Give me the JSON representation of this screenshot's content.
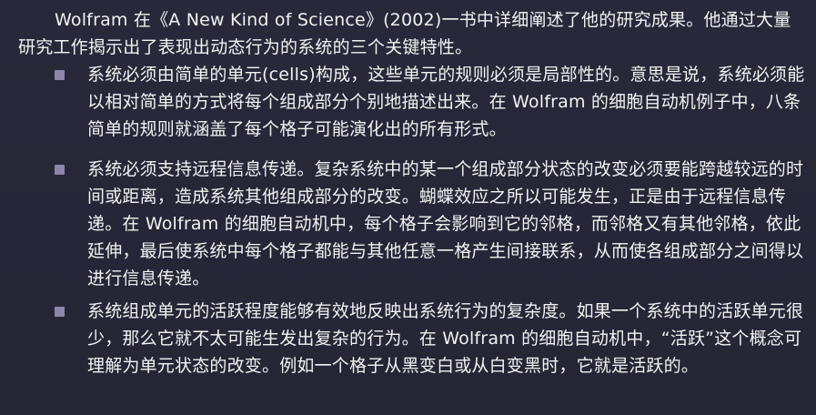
{
  "document": {
    "intro": "Wolfram 在《A New Kind of Science》(2002)一书中详细阐述了他的研究成果。他通过大量研究工作揭示出了表现出动态行为的系统的三个关键特性。",
    "items": [
      {
        "text": "系统必须由简单的单元(cells)构成，这些单元的规则必须是局部性的。意思是说，系统必须能以相对简单的方式将每个组成部分个别地描述出来。在 Wolfram 的细胞自动机例子中，八条简单的规则就涵盖了每个格子可能演化出的所有形式。"
      },
      {
        "text": "系统必须支持远程信息传递。复杂系统中的某一个组成部分状态的改变必须要能跨越较远的时间或距离，造成系统其他组成部分的改变。蝴蝶效应之所以可能发生，正是由于远程信息传递。在 Wolfram 的细胞自动机中，每个格子会影响到它的邻格，而邻格又有其他邻格，依此延伸，最后使系统中每个格子都能与其他任意一格产生间接联系，从而使各组成部分之间得以进行信息传递。"
      },
      {
        "text": "系统组成单元的活跃程度能够有效地反映出系统行为的复杂度。如果一个系统中的活跃单元很少，那么它就不太可能生发出复杂的行为。在 Wolfram 的细胞自动机中，“活跃”这个概念可理解为单元状态的改变。例如一个格子从黑变白或从白变黑时，它就是活跃的。"
      }
    ],
    "colors": {
      "background": "#262637",
      "text": "#f2f2f2",
      "bullet": "#8e86a8"
    },
    "icons": {
      "bullet": "square-bullet-icon"
    }
  }
}
